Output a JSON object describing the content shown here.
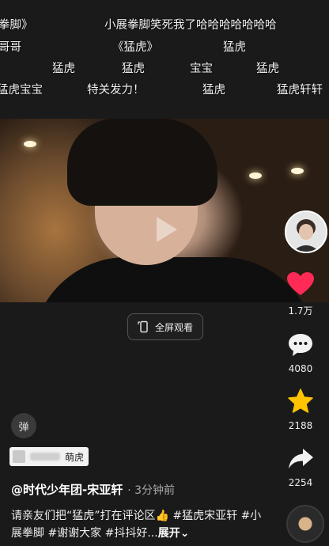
{
  "danmaku": [
    "拳脚》",
    "小展拳脚笑死我了哈哈哈哈哈哈哈",
    "哥哥",
    "《猛虎》",
    "猛虎",
    "猛虎",
    "猛虎",
    "宝宝",
    "猛虎",
    "猛虎宝宝",
    "特关发力！",
    "猛虎",
    "猛虎轩轩"
  ],
  "fullscreen_label": "全屏观看",
  "rail": {
    "likes": "1.7万",
    "comments": "4080",
    "favorites": "2188",
    "shares": "2254"
  },
  "danmaku_toggle": "弹",
  "tag_name": "萌虎",
  "author": "@时代少年团-宋亚轩",
  "time_ago": "· 3分钟前",
  "description": {
    "text": "请亲友们把“猛虎”打在评论区👍 #猛虎宋亚轩 #小展拳脚 #谢谢大家 #抖抖好...",
    "more": "展开⌄"
  },
  "colors": {
    "like": "#ff2a55",
    "favorite": "#ffc300",
    "background": "#1a1a1a"
  },
  "icons": [
    "play-icon",
    "fullscreen-icon",
    "heart-icon",
    "comment-icon",
    "star-icon",
    "share-icon",
    "music-disc-icon"
  ]
}
